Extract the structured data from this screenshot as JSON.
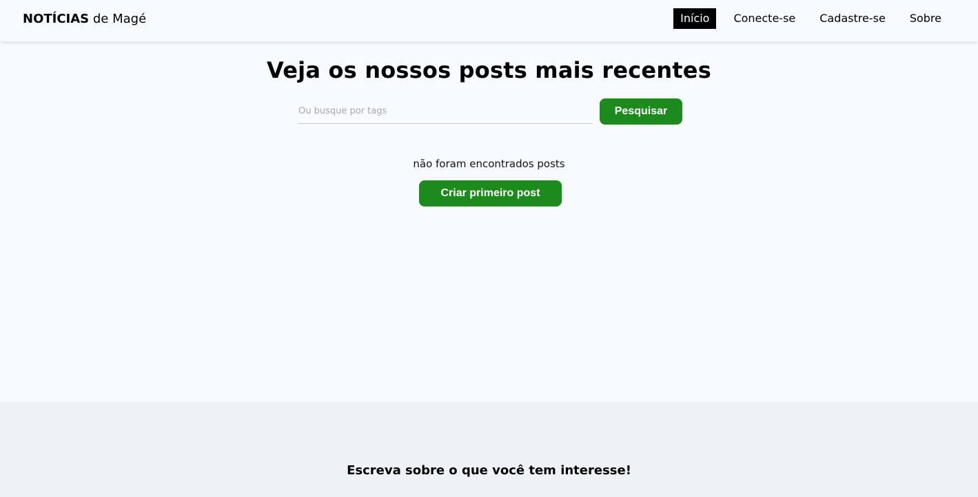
{
  "navbar": {
    "brand_strong": "NOTÍCIAS",
    "brand_rest": " de Magé",
    "links": [
      {
        "label": "Início",
        "active": true
      },
      {
        "label": "Conecte-se",
        "active": false
      },
      {
        "label": "Cadastre-se",
        "active": false
      },
      {
        "label": "Sobre",
        "active": false
      }
    ]
  },
  "main": {
    "headline": "Veja os nossos posts mais recentes",
    "search": {
      "placeholder": "Ou busque por tags",
      "value": "",
      "button_label": "Pesquisar"
    },
    "empty_message": "não foram encontrados posts",
    "create_button_label": "Criar primeiro post"
  },
  "footer": {
    "text": "Escreva sobre o que você tem interesse!"
  },
  "colors": {
    "page_background": "#f7fbff",
    "footer_background": "#eef2f6",
    "accent_green": "#1c8a1c",
    "active_nav_background": "#000000"
  }
}
